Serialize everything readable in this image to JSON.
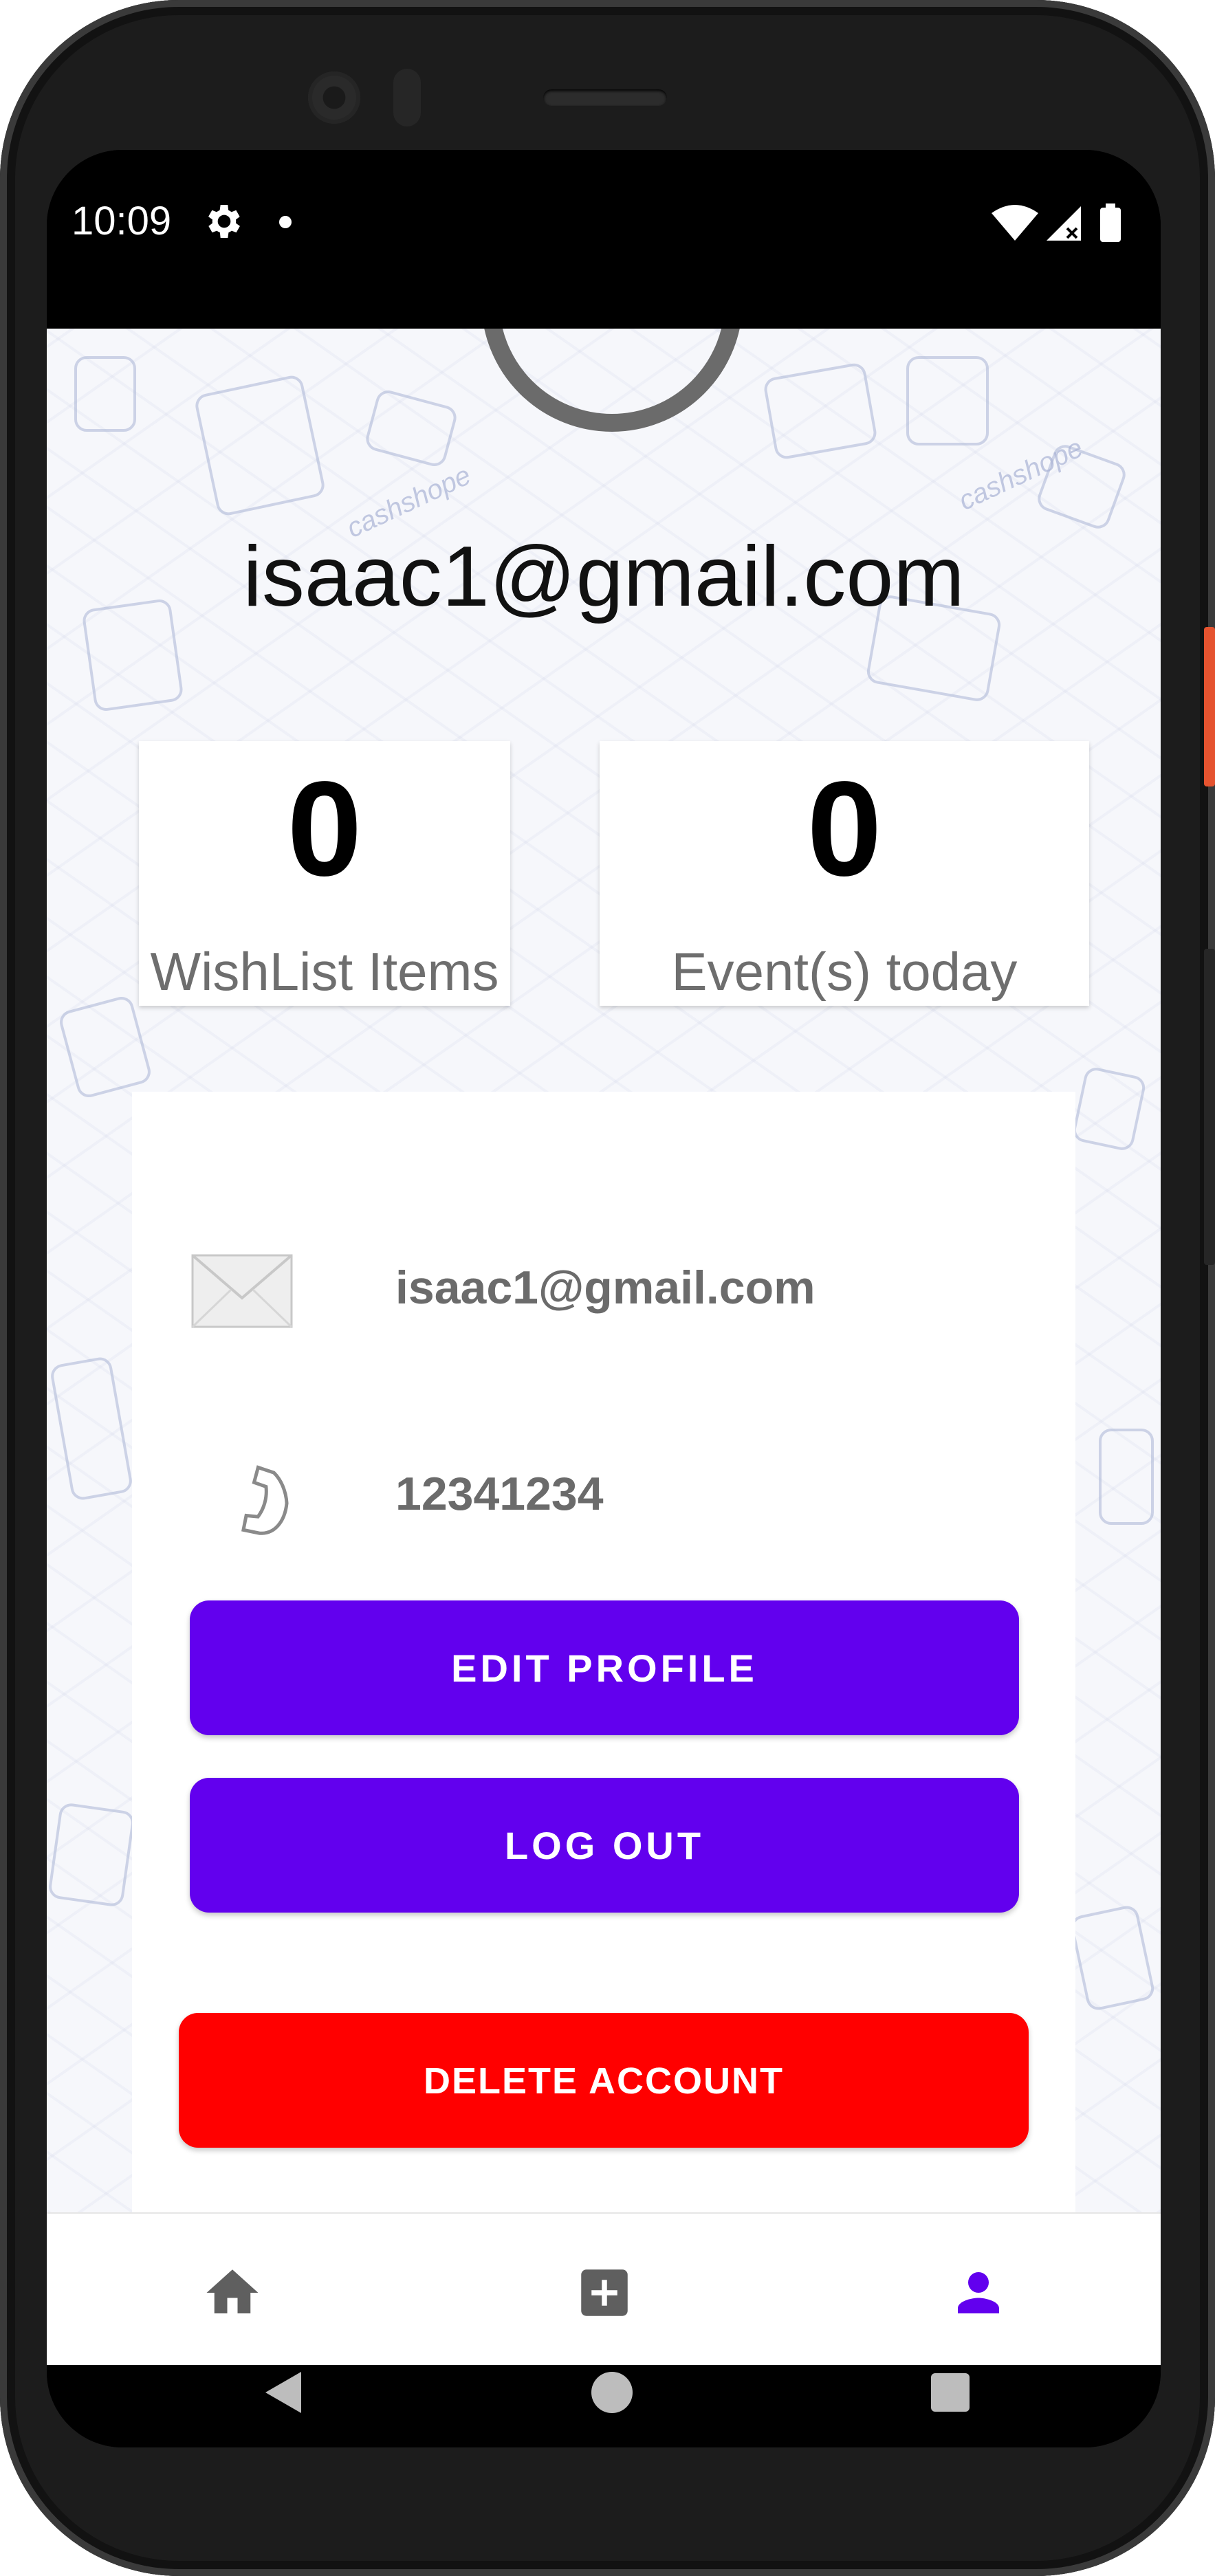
{
  "status_bar": {
    "time": "10:09"
  },
  "profile": {
    "header_email": "isaac1@gmail.com",
    "stats": [
      {
        "value": "0",
        "label": "WishList Items"
      },
      {
        "value": "0",
        "label": "Event(s) today"
      }
    ],
    "info": {
      "email": "isaac1@gmail.com",
      "phone": "12341234"
    }
  },
  "buttons": {
    "edit_profile": "EDIT PROFILE",
    "log_out": "LOG OUT",
    "delete_account": "DELETE ACCOUNT"
  },
  "bottom_nav": {
    "items": [
      {
        "icon": "home-icon",
        "active": false
      },
      {
        "icon": "add-box-icon",
        "active": false
      },
      {
        "icon": "person-icon",
        "active": true
      }
    ]
  },
  "pattern_text": "cashshope",
  "colors": {
    "primary": "#6200ee",
    "danger": "#ff0000",
    "nav_inactive": "#5f5f5f",
    "nav_active": "#6200ee"
  }
}
